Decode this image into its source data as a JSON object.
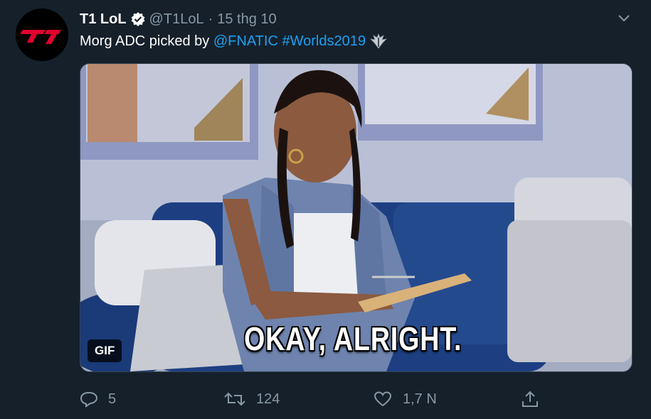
{
  "author": {
    "display_name": "T1 LoL",
    "handle": "@T1LoL",
    "separator": "·",
    "timestamp": "15 thg 10",
    "avatar_logo_text": "T1"
  },
  "tweet": {
    "text_plain": "Morg ADC picked by ",
    "mention": "@FNATIC",
    "hashtag": "#Worlds2019"
  },
  "media": {
    "type": "GIF",
    "caption": "OKAY, ALRIGHT.",
    "badge": "GIF"
  },
  "actions": {
    "reply_count": "5",
    "retweet_count": "124",
    "like_count": "1,7 N"
  },
  "icons": {
    "verified": "verified-badge-icon",
    "more": "chevron-down-icon",
    "reply": "reply-icon",
    "retweet": "retweet-icon",
    "like": "heart-icon",
    "share": "share-icon",
    "worlds": "worlds-trophy-icon"
  },
  "colors": {
    "background": "#15202b",
    "text_primary": "#ffffff",
    "text_secondary": "#8899a6",
    "link": "#1da1f2",
    "logo_red": "#e2012d"
  }
}
